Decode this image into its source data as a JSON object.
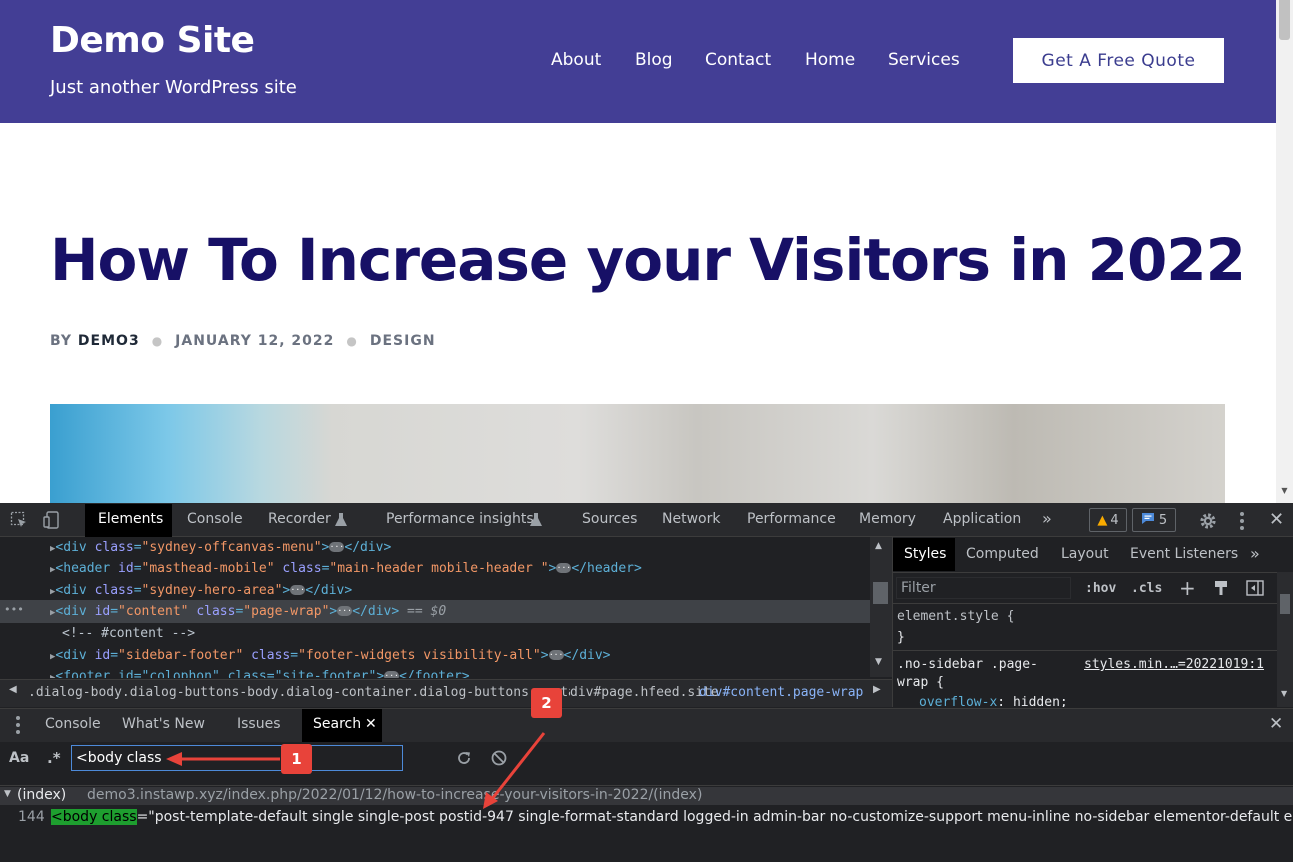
{
  "site": {
    "title": "Demo Site",
    "tagline": "Just another WordPress site",
    "nav": [
      "About",
      "Blog",
      "Contact",
      "Home",
      "Services"
    ],
    "cta": "Get A Free Quote",
    "colors": {
      "header_bg": "#433e95",
      "title_color": "#171066"
    }
  },
  "post": {
    "title": "How To Increase your Visitors in 2022",
    "by_label": "BY",
    "author": "DEMO3",
    "date": "JANUARY 12, 2022",
    "category": "DESIGN"
  },
  "devtools": {
    "tabs": [
      "Elements",
      "Console",
      "Recorder",
      "Performance insights",
      "Sources",
      "Network",
      "Performance",
      "Memory",
      "Application"
    ],
    "more": "»",
    "warnings": "4",
    "messages": "5",
    "elements": {
      "lines": [
        {
          "tag": "<div ",
          "attrs": [
            [
              "class",
              "\"sydney-offcanvas-menu\""
            ]
          ],
          "end": "</div>"
        },
        {
          "tag": "<header ",
          "attrs": [
            [
              "id",
              "\"masthead-mobile\""
            ],
            [
              "class",
              "\"main-header mobile-header \""
            ]
          ],
          "end": "</header>"
        },
        {
          "tag": "<div ",
          "attrs": [
            [
              "class",
              "\"sydney-hero-area\""
            ]
          ],
          "end": "</div>"
        },
        {
          "tag": "<div ",
          "attrs": [
            [
              "id",
              "\"content\""
            ],
            [
              "class",
              "\"page-wrap\""
            ]
          ],
          "end": "</div>"
        }
      ],
      "selected_suffix": "== $0",
      "comment": "<!-- #content -->",
      "line6_tag": "<div ",
      "line6_attr1": "id",
      "line6_val1": "\"sidebar-footer\"",
      "line6_attr2": "class",
      "line6_val2": "\"footer-widgets visibility-all\"",
      "line6_end": "</div>",
      "line7": "<footer id=\"colophon\" class=\"site-footer\">",
      "line7_end": "</footer>"
    },
    "breadcrumbs": [
      ".dialog-body.dialog-buttons-body.dialog-container.dialog-buttons-containe",
      "div#page.hfeed.site",
      "div#content.page-wrap"
    ],
    "styles": {
      "tabs": [
        "Styles",
        "Computed",
        "Layout",
        "Event Listeners"
      ],
      "filter_placeholder": "Filter",
      "hov": ":hov",
      "cls": ".cls",
      "rule1": "element.style {",
      "rule1_close": "}",
      "rule2_selector": ".no-sidebar .page-",
      "rule2_selector2": "wrap {",
      "rule2_source": "styles.min.…=20221019:1",
      "rule2_prop": "overflow-x",
      "rule2_value": "hidden;"
    },
    "drawer": {
      "tabs": [
        "Console",
        "What's New",
        "Issues",
        "Search"
      ],
      "active": "Search",
      "match_case": "Aa",
      "regex": ".*",
      "query": "<body class",
      "result_file": "(index)",
      "result_url": "demo3.instawp.xyz/index.php/2022/01/12/how-to-increase-your-visitors-in-2022/(index)",
      "result_line_no": "144",
      "result_match": "<body class",
      "result_rest": "=\"post-template-default single single-post postid-947 single-format-standard logged-in admin-bar no-customize-support menu-inline no-sidebar elementor-default element…"
    }
  },
  "annotations": {
    "badge1": "1",
    "badge2": "2",
    "color": "#e8433a"
  }
}
